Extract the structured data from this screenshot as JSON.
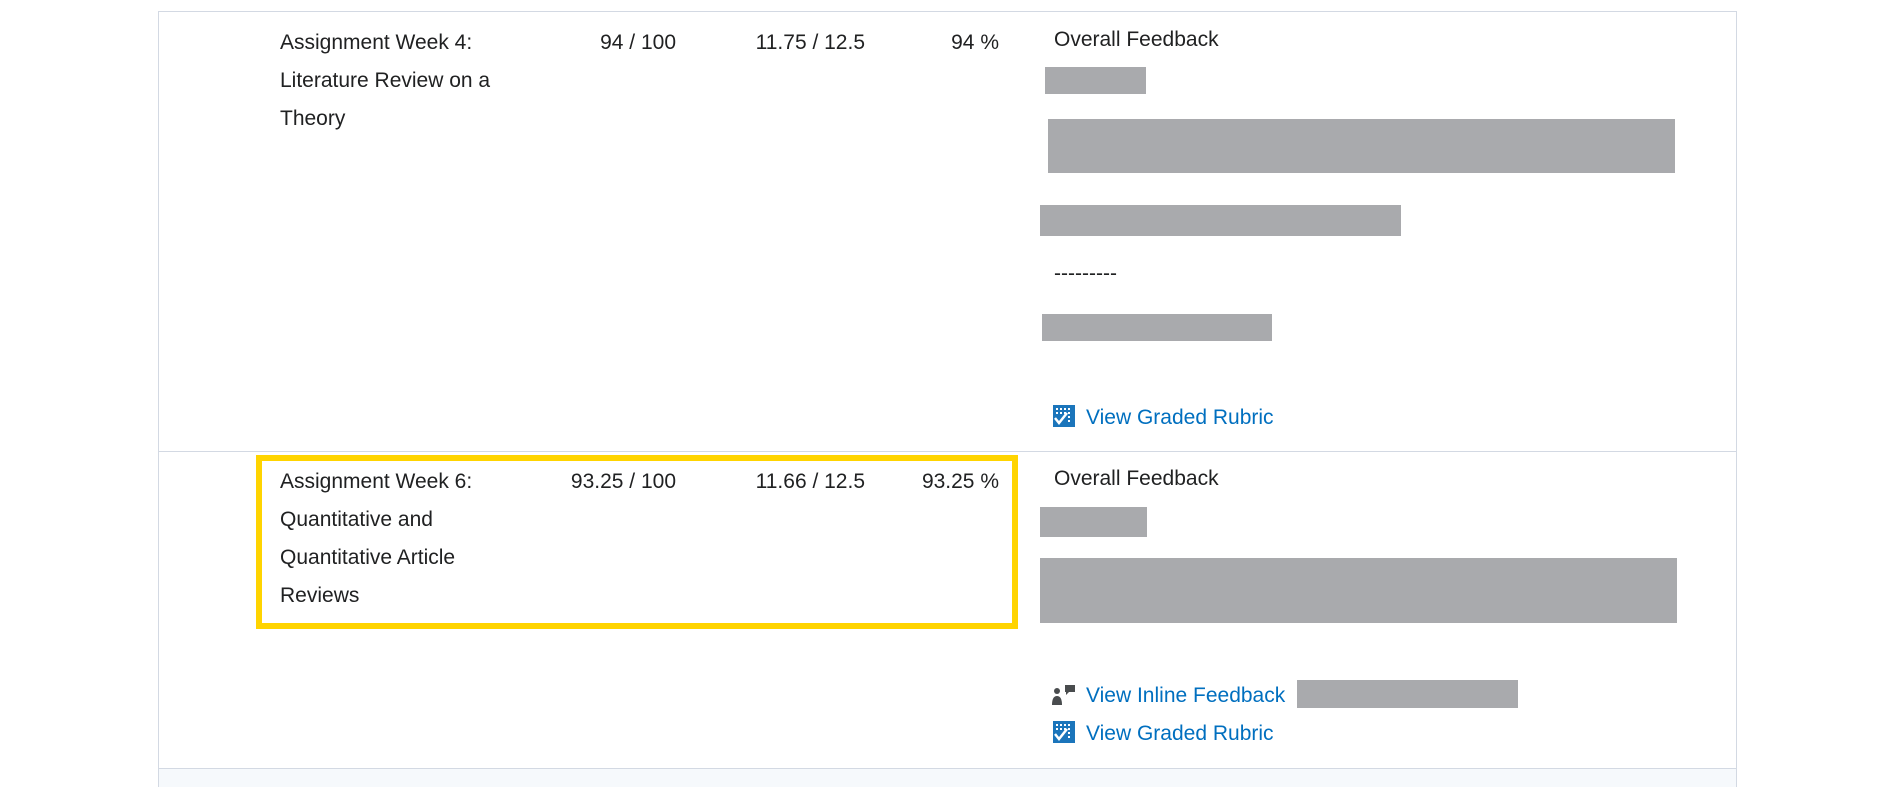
{
  "rows": [
    {
      "title_lines": [
        "Assignment Week 4:",
        "Literature Review on a",
        "Theory"
      ],
      "score": "94 / 100",
      "weighted": "11.75 / 12.5",
      "percent": "94 %",
      "feedback_heading": "Overall Feedback",
      "feedback_separator": "---------",
      "links": {
        "rubric": "View Graded Rubric"
      }
    },
    {
      "title_lines": [
        "Assignment Week 6:",
        "Quantitative and",
        "Quantitative Article",
        "Reviews"
      ],
      "score": "93.25 / 100",
      "weighted": "11.66 / 12.5",
      "percent": "93.25 %",
      "feedback_heading": "Overall Feedback",
      "links": {
        "inline": "View Inline Feedback",
        "rubric": "View Graded Rubric"
      },
      "highlighted": true
    }
  ],
  "colors": {
    "link": "#006fbf",
    "highlight": "#ffd400",
    "redaction": "#a9aaad",
    "border": "#d3d9e3"
  },
  "icons": {
    "rubric": "rubric-check-icon",
    "inline": "inline-feedback-icon"
  }
}
